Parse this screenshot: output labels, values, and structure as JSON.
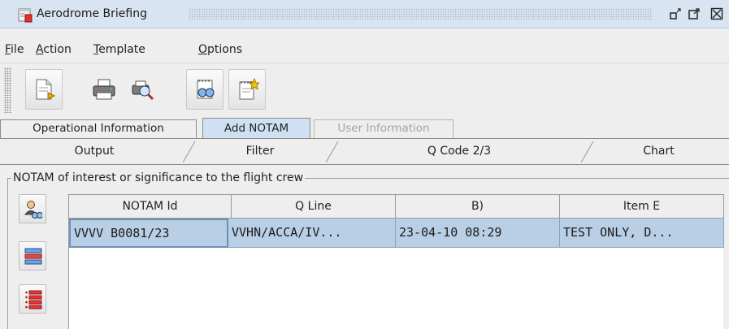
{
  "window": {
    "title": "Aerodrome Briefing"
  },
  "menu": {
    "items": [
      {
        "mnemonic": "F",
        "rest": "ile"
      },
      {
        "mnemonic": "A",
        "rest": "ction"
      },
      {
        "mnemonic": "T",
        "rest": "emplate"
      },
      {
        "mnemonic": "O",
        "rest": "ptions"
      }
    ]
  },
  "toolbar": {
    "buttons": [
      "new-document-icon",
      "print-icon",
      "print-preview-icon",
      "view-notam-icon",
      "new-notam-icon"
    ]
  },
  "tabs_primary": [
    "Operational Information",
    "Add NOTAM",
    "User Information"
  ],
  "tabs_primary_selected": "Add NOTAM",
  "tabs_primary_disabled": "User Information",
  "tabs_secondary": [
    "Output",
    "Filter",
    "Q Code 2/3",
    "Chart"
  ],
  "group": {
    "title": "NOTAM of interest or significance to the flight crew"
  },
  "side_buttons": [
    "user-search-icon",
    "edit-list-icon",
    "list-icon"
  ],
  "table": {
    "columns": [
      "NOTAM Id",
      "Q Line",
      "B)",
      "Item E"
    ],
    "rows": [
      [
        "VVVV B0081/23",
        "VVHN/ACCA/IV...",
        "23-04-10 08:29",
        "TEST ONLY, D..."
      ]
    ],
    "selected_row": 0
  },
  "colors": {
    "selection": "#b8cfe5",
    "selected_tab": "#cfe0f3",
    "titlebar": "#d9e4f2"
  }
}
